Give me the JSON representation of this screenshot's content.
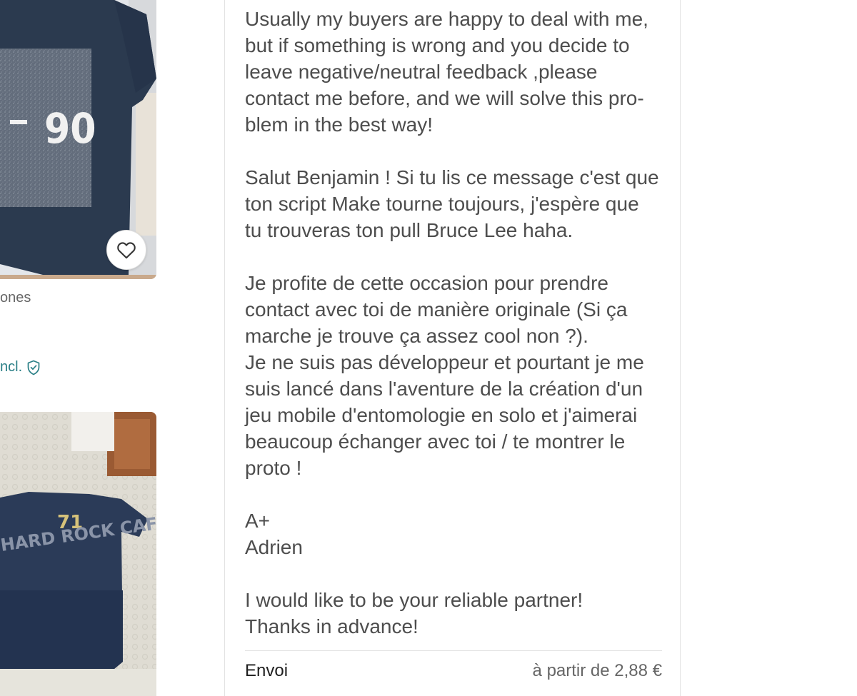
{
  "listings": {
    "item1": {
      "image_alt": "navy t-shirt with -90 print",
      "print_text": "-90",
      "brand_partial": "ones",
      "price_incl_partial": "ncl."
    },
    "item2": {
      "image_alt": "navy Hard Rock Cafe t-shirt",
      "print_text": "HARD ROCK CAFE",
      "number": "71"
    }
  },
  "description": {
    "text": "Usually my buyers are happy to deal with me,\nbut if something is wrong and you decide to\nleave negative/neutral feedback ,please\ncontact me before, and we will solve this pro-\nblem in the best way!\n\nSalut Benjamin ! Si tu lis ce message c'est que\nton script Make tourne toujours, j'espère que\ntu trouveras ton pull Bruce Lee haha.\n\nJe profite de cette occasion pour prendre\ncontact avec toi de manière originale (Si ça\nmarche je trouve ça assez cool non ?).\nJe ne suis pas développeur et pourtant je me\nsuis lancé dans l'aventure de la création d'un\njeu mobile d'entomologie en solo et j'aimerai\nbeaucoup échanger avec toi / te montrer le\nproto !\n\nA+\nAdrien\n\nI would like to be your reliable partner!\nThanks in advance!"
  },
  "shipping": {
    "label": "Envoi",
    "value": "à partir de 2,88 €"
  },
  "colors": {
    "text": "#4d4d4d",
    "accent": "#2a7f86",
    "divider": "#e3e3e3"
  },
  "icons": {
    "favorite": "heart-outline-icon",
    "buyer_protection": "shield-check-icon"
  }
}
